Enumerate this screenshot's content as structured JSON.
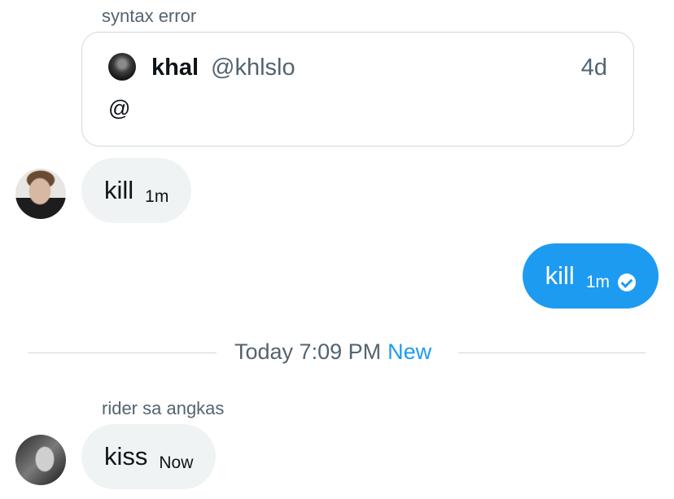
{
  "conversation": {
    "first_sender_name": "syntax error",
    "quoted_tweet": {
      "name": "khal",
      "handle": "@khlslo",
      "time": "4d",
      "text": "@"
    },
    "message_in_1": {
      "text": "kill",
      "time": "1m"
    },
    "message_out_1": {
      "text": "kill",
      "time": "1m",
      "status_icon": "check-circle-icon"
    },
    "divider": {
      "date": "Today 7:09 PM",
      "new_label": "New"
    },
    "second_sender_name": "rider sa angkas",
    "message_in_2": {
      "text": "kiss",
      "time": "Now"
    }
  },
  "colors": {
    "accent": "#1d9bf0",
    "bubble_incoming": "#eff3f4",
    "secondary_text": "#536471",
    "border": "#cfd9de"
  }
}
